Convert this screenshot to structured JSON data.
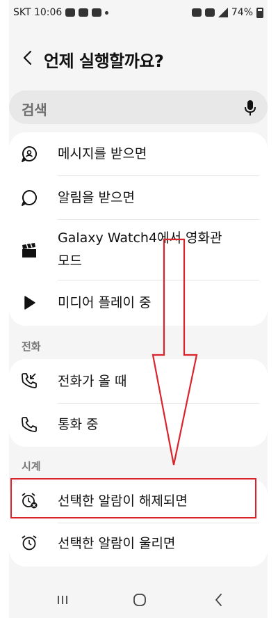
{
  "status_bar": {
    "carrier_time": "SKT 10:06",
    "battery": "74%"
  },
  "header": {
    "title": "언제 실행할까요?"
  },
  "search": {
    "placeholder": "검색"
  },
  "general_items": [
    {
      "label": "메시지를 받으면",
      "icon": "message-bubble-icon"
    },
    {
      "label": "알림을 받으면",
      "icon": "notification-bubble-icon"
    },
    {
      "label": "Galaxy Watch4에서 영화관",
      "label2": "모드",
      "icon": "clapperboard-icon"
    },
    {
      "label": "미디어 플레이 중",
      "icon": "play-icon"
    }
  ],
  "call_section": {
    "title": "전화",
    "items": [
      {
        "label": "전화가 올 때",
        "icon": "incoming-call-icon"
      },
      {
        "label": "통화 중",
        "icon": "phone-icon"
      }
    ]
  },
  "clock_section": {
    "title": "시계",
    "items": [
      {
        "label": "선택한 알람이 해제되면",
        "icon": "alarm-off-icon"
      },
      {
        "label": "선택한 알람이 울리면",
        "icon": "alarm-icon"
      }
    ]
  },
  "colors": {
    "background": "#f5f5f5",
    "card": "#ffffff",
    "annotation": "#d9232d"
  }
}
